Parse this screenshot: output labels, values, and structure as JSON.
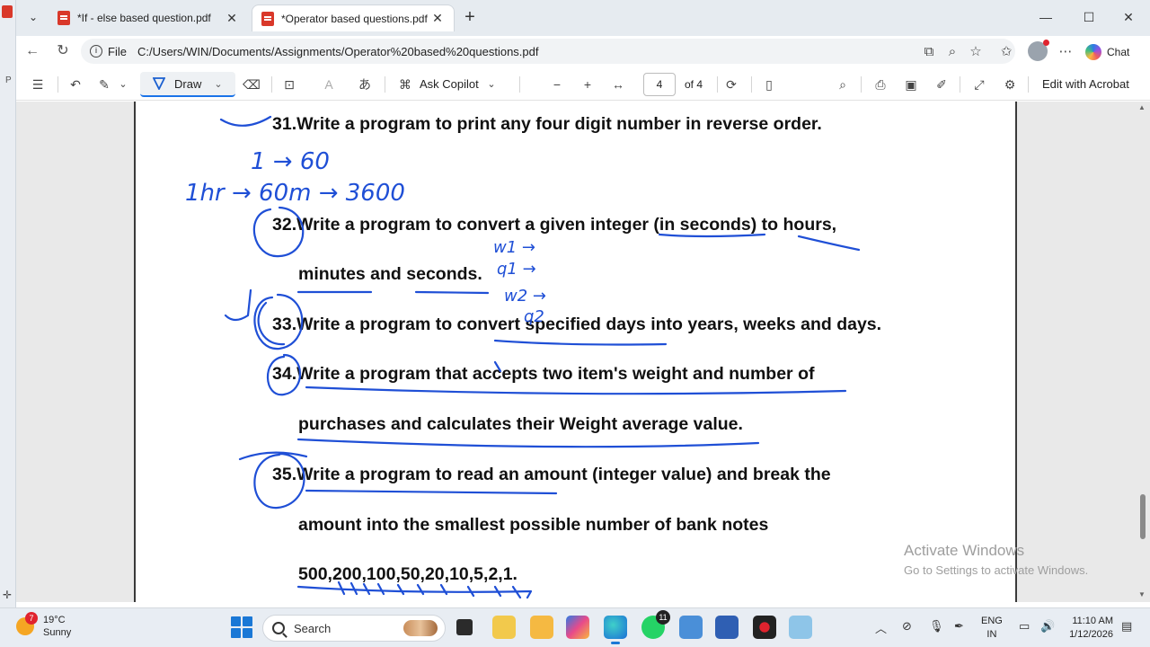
{
  "browser": {
    "tabs": [
      {
        "title": "*If - else based question.pdf",
        "active": false
      },
      {
        "title": "*Operator based questions.pdf",
        "active": true
      }
    ],
    "new_tab": "+",
    "window_controls": {
      "minimize": "—",
      "maximize": "☐",
      "close": "✕"
    },
    "address": {
      "scheme_label": "File",
      "url": "C:/Users/WIN/Documents/Assignments/Operator%20based%20questions.pdf"
    },
    "chat_label": "Chat"
  },
  "pdf_toolbar": {
    "draw_label": "Draw",
    "ask_copilot_label": "Ask Copilot",
    "page_current": "4",
    "page_total": "of 4",
    "edit_label": "Edit with Acrobat"
  },
  "document": {
    "questions": [
      "31.Write a program to print any four digit number in reverse order.",
      "32.Write a program to convert a given integer (in seconds) to hours,",
      "minutes and seconds.",
      "33.Write a program to convert specified days into years, weeks and days.",
      "34.Write a  program that accepts two item's weight and number of",
      "purchases and calculates their Weight average value.",
      "35.Write a program to read an amount (integer value) and break the",
      "amount into the smallest possible number of bank notes",
      "500,200,100,50,20,10,5,2,1."
    ],
    "annotations": {
      "line1": "1 → 60",
      "line2": "1hr → 60m → 3600",
      "w1": "w1 →",
      "q1": "q1 →",
      "w2": "w2 →",
      "q2": "q2"
    }
  },
  "watermark": {
    "line1": "Activate Windows",
    "line2": "Go to Settings to activate Windows."
  },
  "taskbar": {
    "weather_temp": "19°C",
    "weather_desc": "Sunny",
    "weather_badge": "7",
    "search_placeholder": "Search",
    "whatsapp_badge": "11",
    "lang_line1": "ENG",
    "lang_line2": "IN",
    "time": "11:10 AM",
    "date": "1/12/2026"
  },
  "colors": {
    "ink": "#1f4fd6",
    "accent": "#1a73e8",
    "pdf_red": "#d9382a"
  }
}
